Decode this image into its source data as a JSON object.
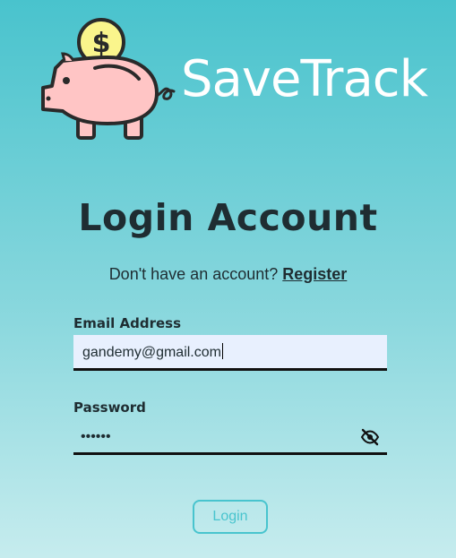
{
  "brand": {
    "name": "SaveTrack",
    "logo_icon": "piggy-bank-with-dollar-coin-icon"
  },
  "page": {
    "title": "Login Account",
    "register_prompt": "Don't have an account?",
    "register_link": "Register"
  },
  "form": {
    "email": {
      "label": "Email Address",
      "value": "gandemy@gmail.com"
    },
    "password": {
      "label": "Password",
      "masked_value": "••••••",
      "visibility_icon": "eye-slash-icon"
    },
    "submit_label": "Login"
  },
  "colors": {
    "accent": "#48c4ce",
    "text": "#1f2d32",
    "autofill_bg": "#e8f0fe",
    "piggy": "#ffc5c5",
    "coin": "#faf58c"
  }
}
